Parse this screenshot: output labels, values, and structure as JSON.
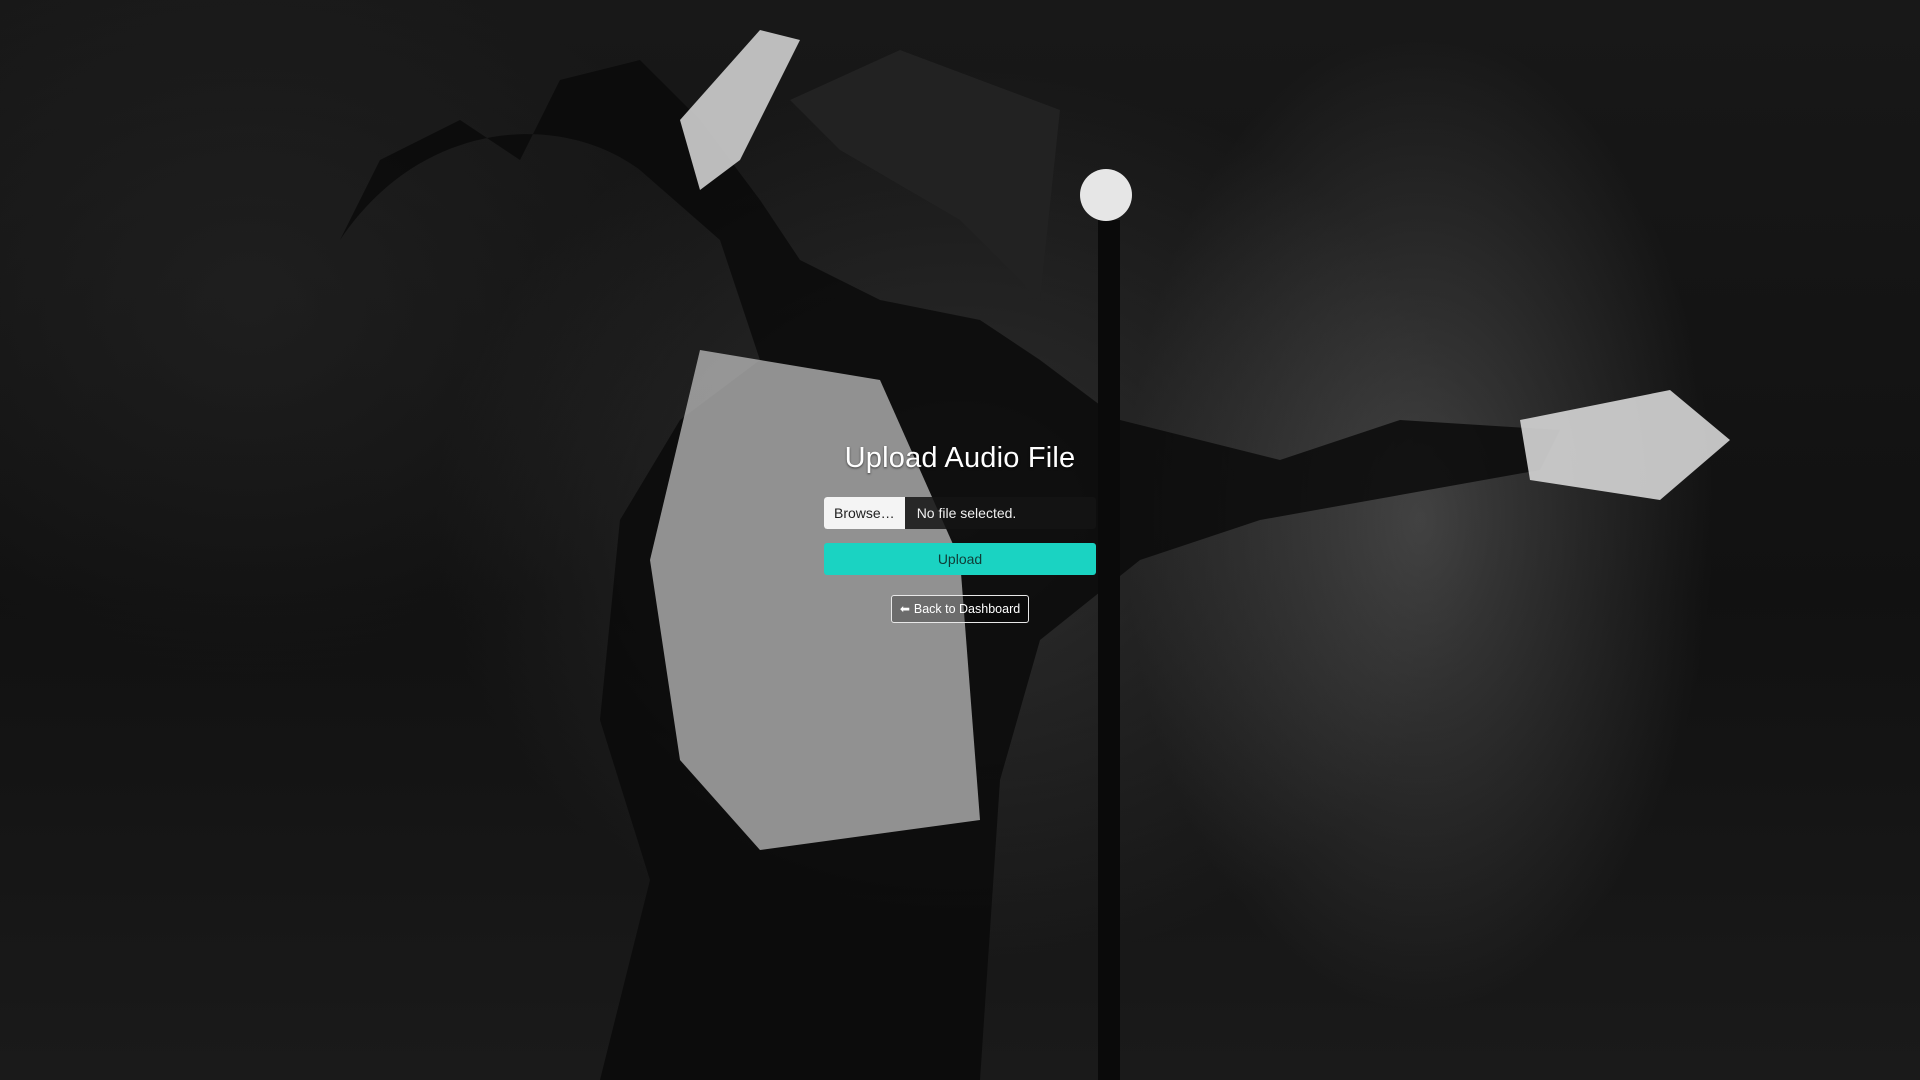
{
  "page": {
    "title": "Upload Audio File"
  },
  "file_input": {
    "browse_label": "Browse…",
    "status": "No file selected."
  },
  "actions": {
    "upload_label": "Upload",
    "back_label": "Back to Dashboard",
    "back_icon": "arrow-left-icon"
  },
  "colors": {
    "accent": "#1ad3c2",
    "background": "#141414"
  }
}
